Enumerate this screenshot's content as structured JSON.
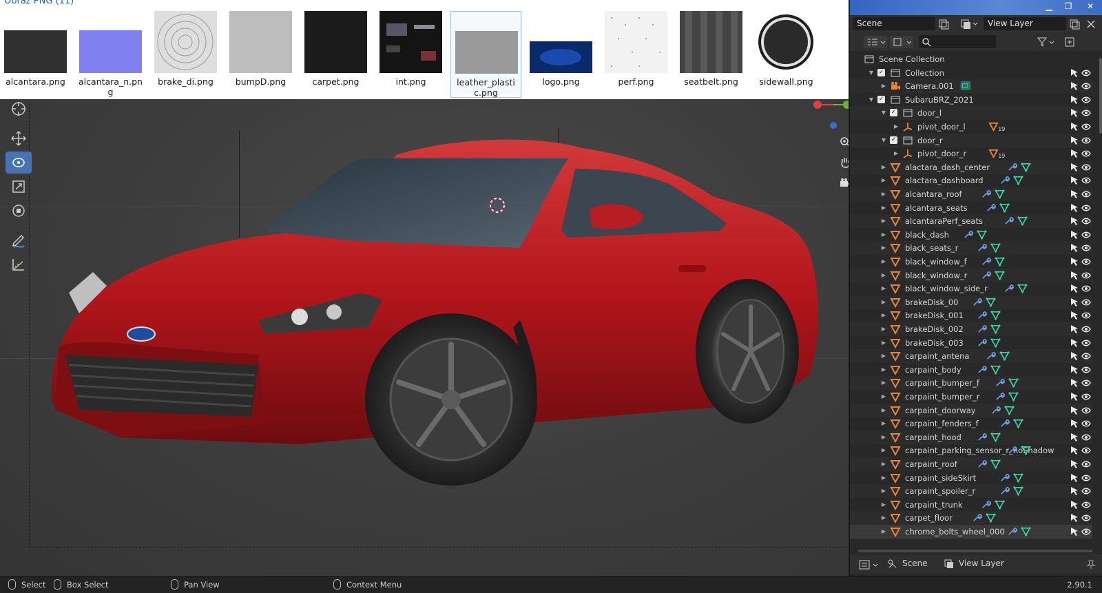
{
  "file_browser": {
    "title": "Obraz PNG (11)",
    "files": [
      {
        "name": "alcantara.png",
        "selected": false
      },
      {
        "name": "alcantara_n.png",
        "selected": false
      },
      {
        "name": "brake_di.png",
        "selected": false
      },
      {
        "name": "bumpD.png",
        "selected": false
      },
      {
        "name": "carpet.png",
        "selected": false
      },
      {
        "name": "int.png",
        "selected": false
      },
      {
        "name": "leather_plastic.png",
        "selected": true
      },
      {
        "name": "logo.png",
        "selected": false
      },
      {
        "name": "perf.png",
        "selected": false
      },
      {
        "name": "seatbelt.png",
        "selected": false
      },
      {
        "name": "sidewall.png",
        "selected": false
      }
    ]
  },
  "header": {
    "scene_label": "Scene",
    "view_layer_label": "View Layer"
  },
  "outliner": {
    "root": "Scene Collection",
    "rows": [
      {
        "label": "Collection",
        "type": "collection",
        "depth": 1,
        "expanded": true,
        "checkbox": true
      },
      {
        "label": "Camera.001",
        "type": "camera",
        "depth": 2,
        "expanded": false,
        "checkbox": false
      },
      {
        "label": "SubaruBRZ_2021",
        "type": "collection",
        "depth": 1,
        "expanded": true,
        "checkbox": true
      },
      {
        "label": "door_l",
        "type": "collection",
        "depth": 2,
        "expanded": true,
        "checkbox": true
      },
      {
        "label": "pivot_door_l",
        "type": "empty",
        "depth": 3,
        "expanded": false,
        "checkbox": false,
        "count": "19"
      },
      {
        "label": "door_r",
        "type": "collection",
        "depth": 2,
        "expanded": true,
        "checkbox": true
      },
      {
        "label": "pivot_door_r",
        "type": "empty",
        "depth": 3,
        "expanded": false,
        "checkbox": false,
        "count": "19"
      },
      {
        "label": "alactara_dash_center",
        "type": "mesh",
        "depth": 2
      },
      {
        "label": "alactara_dashboard",
        "type": "mesh",
        "depth": 2
      },
      {
        "label": "alcantara_roof",
        "type": "mesh",
        "depth": 2
      },
      {
        "label": "alcantara_seats",
        "type": "mesh",
        "depth": 2
      },
      {
        "label": "alcantaraPerf_seats",
        "type": "mesh",
        "depth": 2
      },
      {
        "label": "black_dash",
        "type": "mesh",
        "depth": 2
      },
      {
        "label": "black_seats_r",
        "type": "mesh",
        "depth": 2
      },
      {
        "label": "black_window_f",
        "type": "mesh",
        "depth": 2
      },
      {
        "label": "black_window_r",
        "type": "mesh",
        "depth": 2
      },
      {
        "label": "black_window_side_r",
        "type": "mesh",
        "depth": 2
      },
      {
        "label": "brakeDisk_00",
        "type": "mesh",
        "depth": 2
      },
      {
        "label": "brakeDisk_001",
        "type": "mesh",
        "depth": 2
      },
      {
        "label": "brakeDisk_002",
        "type": "mesh",
        "depth": 2
      },
      {
        "label": "brakeDisk_003",
        "type": "mesh",
        "depth": 2
      },
      {
        "label": "carpaint_antena",
        "type": "mesh",
        "depth": 2
      },
      {
        "label": "carpaint_body",
        "type": "mesh",
        "depth": 2
      },
      {
        "label": "carpaint_bumper_f",
        "type": "mesh",
        "depth": 2
      },
      {
        "label": "carpaint_bumper_r",
        "type": "mesh",
        "depth": 2
      },
      {
        "label": "carpaint_doorway",
        "type": "mesh",
        "depth": 2
      },
      {
        "label": "carpaint_fenders_f",
        "type": "mesh",
        "depth": 2
      },
      {
        "label": "carpaint_hood",
        "type": "mesh",
        "depth": 2
      },
      {
        "label": "carpaint_parking_sensor_r_noShadow",
        "type": "mesh",
        "depth": 2
      },
      {
        "label": "carpaint_roof",
        "type": "mesh",
        "depth": 2
      },
      {
        "label": "carpaint_sideSkirt",
        "type": "mesh",
        "depth": 2
      },
      {
        "label": "carpaint_spoiler_r",
        "type": "mesh",
        "depth": 2
      },
      {
        "label": "carpaint_trunk",
        "type": "mesh",
        "depth": 2
      },
      {
        "label": "carpet_floor",
        "type": "mesh",
        "depth": 2
      },
      {
        "label": "chrome_bolts_wheel_000",
        "type": "mesh",
        "depth": 2,
        "selected": true
      }
    ]
  },
  "properties_header": {
    "scene_label": "Scene",
    "view_layer_label": "View Layer"
  },
  "statusbar": {
    "select": "Select",
    "box_select": "Box Select",
    "pan_view": "Pan View",
    "context_menu": "Context Menu",
    "version": "2.90.1"
  },
  "colors": {
    "accent": "#4772b3",
    "mesh_icon": "#e8833a",
    "modifier_icon": "#6f9fe0",
    "data_icon": "#3fd0a8",
    "car_body": "#b3161c"
  }
}
